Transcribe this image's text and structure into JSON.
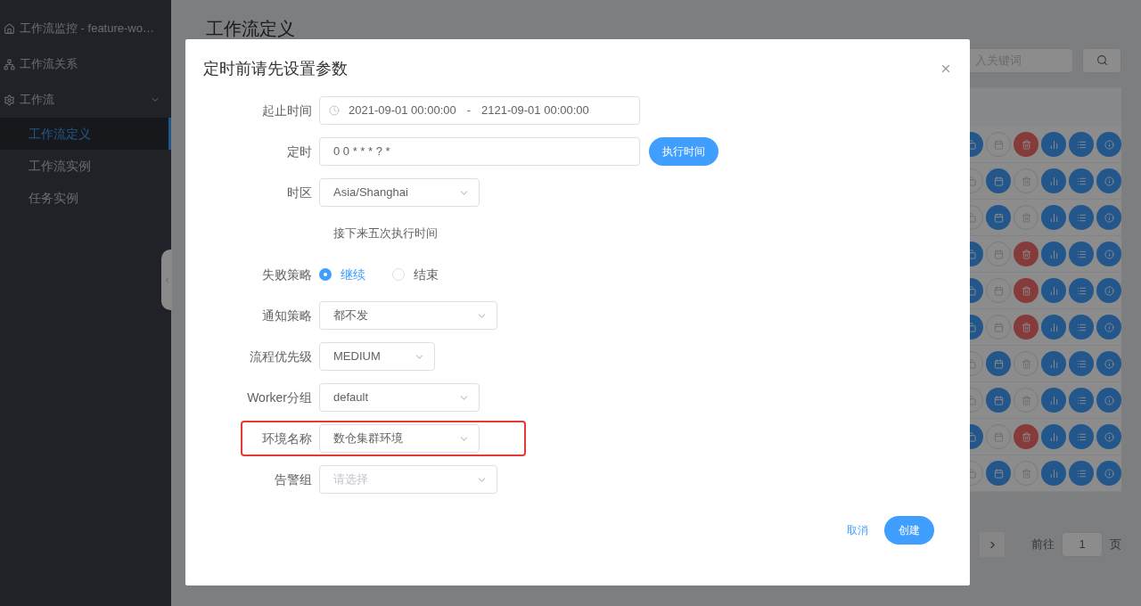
{
  "sidebar": {
    "items": [
      {
        "label": "工作流监控 - feature-wo…",
        "selected": false
      },
      {
        "label": "工作流关系",
        "selected": false
      },
      {
        "label": "工作流",
        "expanded": true,
        "selected": false,
        "children": [
          {
            "label": "工作流定义",
            "selected": true
          },
          {
            "label": "工作流实例",
            "selected": false
          },
          {
            "label": "任务实例",
            "selected": false
          }
        ]
      }
    ]
  },
  "page": {
    "title": "工作流定义",
    "search": {
      "placeholder": "入关键词"
    },
    "rows": [
      {
        "edit_enabled": true,
        "schedule_enabled": false,
        "delete_enabled": true
      },
      {
        "edit_enabled": false,
        "schedule_enabled": true,
        "delete_enabled": false
      },
      {
        "edit_enabled": false,
        "schedule_enabled": true,
        "delete_enabled": false
      },
      {
        "edit_enabled": true,
        "schedule_enabled": false,
        "delete_enabled": true
      },
      {
        "edit_enabled": true,
        "schedule_enabled": false,
        "delete_enabled": true
      },
      {
        "edit_enabled": true,
        "schedule_enabled": false,
        "delete_enabled": true
      },
      {
        "edit_enabled": false,
        "schedule_enabled": true,
        "delete_enabled": false
      },
      {
        "edit_enabled": false,
        "schedule_enabled": true,
        "delete_enabled": false
      },
      {
        "edit_enabled": true,
        "schedule_enabled": false,
        "delete_enabled": true
      },
      {
        "edit_enabled": false,
        "schedule_enabled": true,
        "delete_enabled": false
      }
    ],
    "pagination": {
      "goto_label": "前往",
      "page": "1",
      "page_suffix": "页"
    }
  },
  "dialog": {
    "title": "定时前请先设置参数",
    "fields": [
      {
        "kind": "daterange",
        "label": "起止时间",
        "start": "2021-09-01 00:00:00",
        "separator": "-",
        "end": "2121-09-01 00:00:00"
      },
      {
        "kind": "input",
        "label": "定时",
        "value": "0 0 * * * ? *",
        "button": "执行时间"
      },
      {
        "kind": "select",
        "label": "时区",
        "value": "Asia/Shanghai"
      },
      {
        "kind": "note",
        "text": "接下来五次执行时间"
      },
      {
        "kind": "radio",
        "label": "失败策略",
        "options": [
          {
            "label": "继续",
            "selected": true
          },
          {
            "label": "结束",
            "selected": false
          }
        ]
      },
      {
        "kind": "select",
        "label": "通知策略",
        "value": "都不发"
      },
      {
        "kind": "select",
        "label": "流程优先级",
        "value": "MEDIUM"
      },
      {
        "kind": "select",
        "label": "Worker分组",
        "value": "default"
      },
      {
        "kind": "select",
        "label": "环境名称",
        "value": "数仓集群环境",
        "highlighted": true
      },
      {
        "kind": "select",
        "label": "告警组",
        "placeholder": "请选择"
      }
    ],
    "buttons": {
      "cancel": "取消",
      "confirm": "创建"
    }
  }
}
